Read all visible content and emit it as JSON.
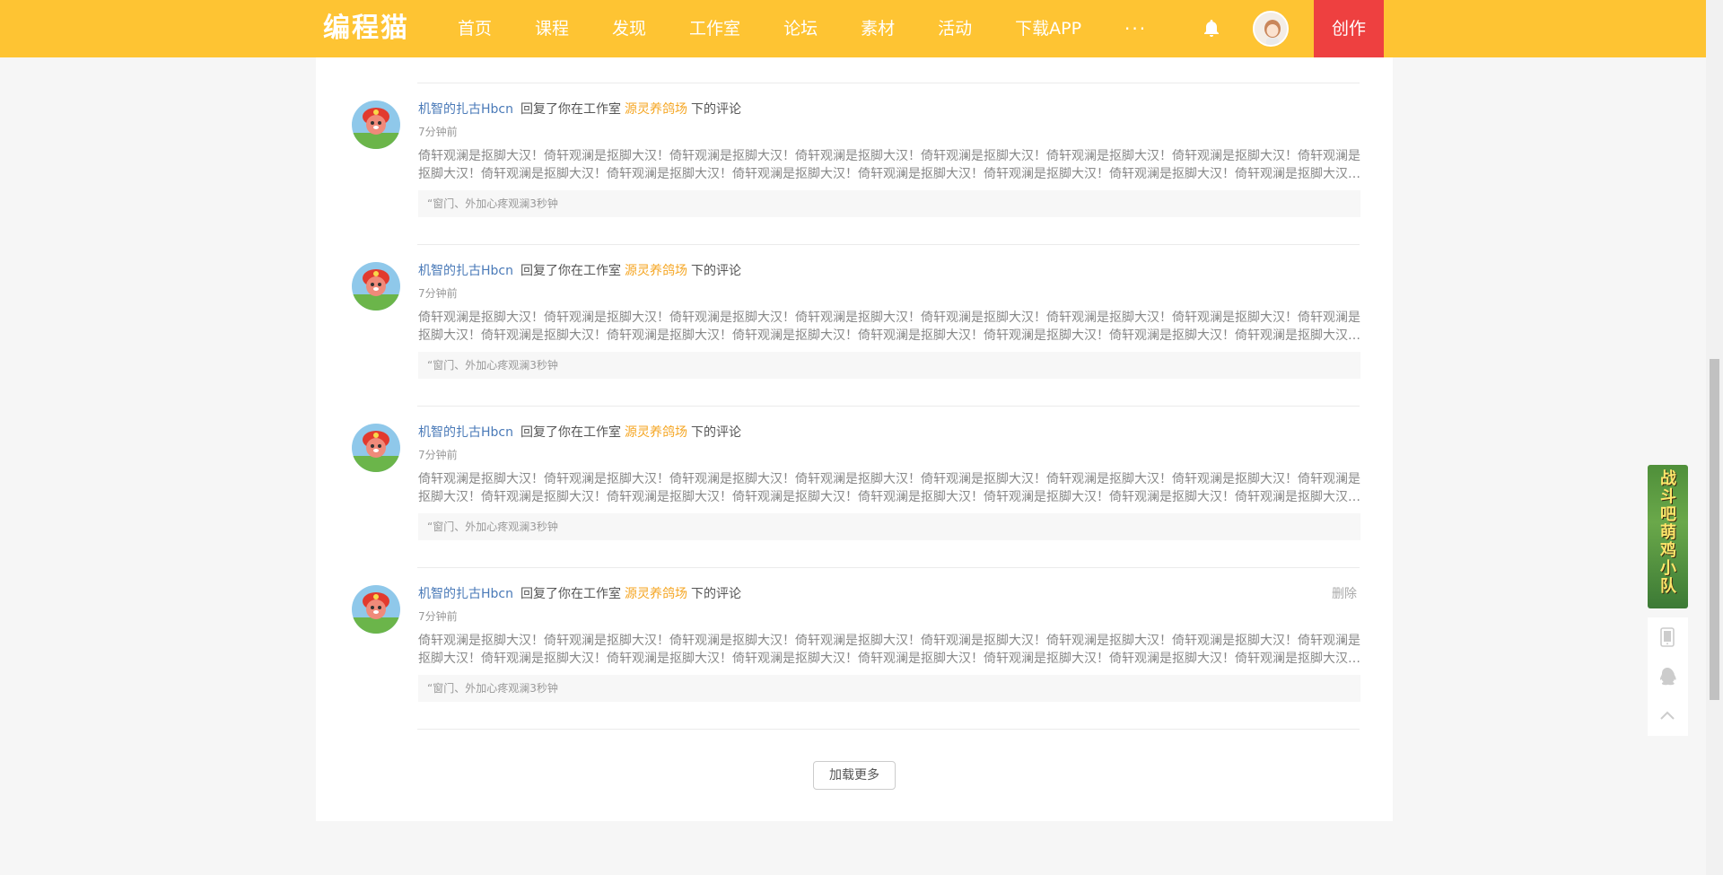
{
  "header": {
    "logo": "编程猫",
    "nav": [
      "首页",
      "课程",
      "发现",
      "工作室",
      "论坛",
      "素材",
      "活动",
      "下载APP"
    ],
    "more": "···",
    "create_label": "创作"
  },
  "notifications": [
    {
      "user": "机智的扎古Hbcn",
      "action": "回复了你在工作室",
      "work": "源灵养鸽场",
      "tail": "下的评论",
      "time": "7分钟前",
      "body": "倚轩观澜是抠脚大汉！倚轩观澜是抠脚大汉！倚轩观澜是抠脚大汉！倚轩观澜是抠脚大汉！倚轩观澜是抠脚大汉！倚轩观澜是抠脚大汉！倚轩观澜是抠脚大汉！倚轩观澜是抠脚大汉！倚轩观澜是抠脚大汉！倚轩观澜是抠脚大汉！倚轩观澜是抠脚大汉！倚轩观澜是抠脚大汉！倚轩观澜是抠脚大汉！倚轩观澜是抠脚大汉！倚轩观澜是抠脚大汉！倚轩观澜是抠脚大汉！",
      "quote": "“窗门、外加心疼观澜3秒钟",
      "delete": ""
    },
    {
      "user": "机智的扎古Hbcn",
      "action": "回复了你在工作室",
      "work": "源灵养鸽场",
      "tail": "下的评论",
      "time": "7分钟前",
      "body": "倚轩观澜是抠脚大汉！倚轩观澜是抠脚大汉！倚轩观澜是抠脚大汉！倚轩观澜是抠脚大汉！倚轩观澜是抠脚大汉！倚轩观澜是抠脚大汉！倚轩观澜是抠脚大汉！倚轩观澜是抠脚大汉！倚轩观澜是抠脚大汉！倚轩观澜是抠脚大汉！倚轩观澜是抠脚大汉！倚轩观澜是抠脚大汉！倚轩观澜是抠脚大汉！倚轩观澜是抠脚大汉！倚轩观澜是抠脚大汉！倚轩观澜是抠脚大汉！",
      "quote": "“窗门、外加心疼观澜3秒钟",
      "delete": ""
    },
    {
      "user": "机智的扎古Hbcn",
      "action": "回复了你在工作室",
      "work": "源灵养鸽场",
      "tail": "下的评论",
      "time": "7分钟前",
      "body": "倚轩观澜是抠脚大汉！倚轩观澜是抠脚大汉！倚轩观澜是抠脚大汉！倚轩观澜是抠脚大汉！倚轩观澜是抠脚大汉！倚轩观澜是抠脚大汉！倚轩观澜是抠脚大汉！倚轩观澜是抠脚大汉！倚轩观澜是抠脚大汉！倚轩观澜是抠脚大汉！倚轩观澜是抠脚大汉！倚轩观澜是抠脚大汉！倚轩观澜是抠脚大汉！倚轩观澜是抠脚大汉！倚轩观澜是抠脚大汉！倚轩观澜是抠脚大汉！",
      "quote": "“窗门、外加心疼观澜3秒钟",
      "delete": ""
    },
    {
      "user": "机智的扎古Hbcn",
      "action": "回复了你在工作室",
      "work": "源灵养鸽场",
      "tail": "下的评论",
      "time": "7分钟前",
      "body": "倚轩观澜是抠脚大汉！倚轩观澜是抠脚大汉！倚轩观澜是抠脚大汉！倚轩观澜是抠脚大汉！倚轩观澜是抠脚大汉！倚轩观澜是抠脚大汉！倚轩观澜是抠脚大汉！倚轩观澜是抠脚大汉！倚轩观澜是抠脚大汉！倚轩观澜是抠脚大汉！倚轩观澜是抠脚大汉！倚轩观澜是抠脚大汉！倚轩观澜是抠脚大汉！倚轩观澜是抠脚大汉！倚轩观澜是抠脚大汉！倚轩观澜是抠脚大汉！",
      "quote": "“窗门、外加心疼观澜3秒钟",
      "delete": "删除"
    }
  ],
  "load_more": "加载更多",
  "promo": {
    "text": "战斗吧萌鸡小队"
  },
  "tools": {
    "icons": [
      "tablet-icon",
      "qq-icon",
      "back-to-top-icon"
    ]
  },
  "colors": {
    "header": "#fec433",
    "create": "#ee4040",
    "user_link": "#4a7ab8",
    "work_link": "#f5a623"
  }
}
